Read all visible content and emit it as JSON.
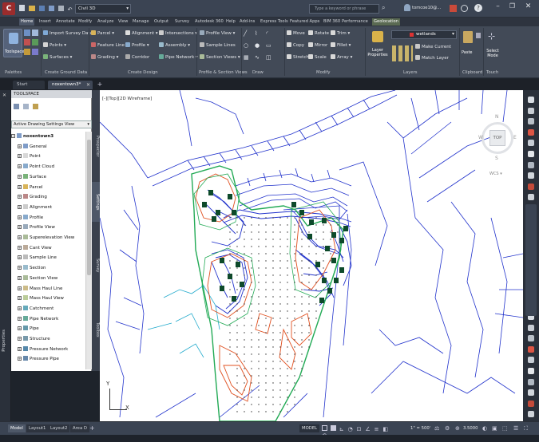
{
  "title_bar": {
    "file_name": "Civil 3D",
    "search_placeholder": "Type a keyword or phrase",
    "user": "tomcoe10@..."
  },
  "ribbon_tabs": [
    "Home",
    "Insert",
    "Annotate",
    "Modify",
    "Analyze",
    "View",
    "Manage",
    "Output",
    "Survey",
    "Autodesk 360",
    "Help",
    "Add-ins",
    "Express Tools",
    "Featured Apps",
    "BIM 360",
    "Performance",
    "Geolocation"
  ],
  "active_ribbon_tab": "Home",
  "ribbon": {
    "toolspace_label": "Toolspace",
    "palettes_label": "Palettes",
    "ground": [
      "Import Survey Data",
      "Points",
      "Surfaces"
    ],
    "ground_panel": "Create Ground Data",
    "design1": [
      "Parcel",
      "Feature Line",
      "Grading"
    ],
    "design2": [
      "Alignment",
      "Profile",
      "Corridor"
    ],
    "design3": [
      "Intersections",
      "Assembly",
      "Pipe Network"
    ],
    "design_panel": "Create Design",
    "profile": [
      "Profile View",
      "Sample Lines",
      "Section Views"
    ],
    "profile_panel": "Profile & Section Views",
    "draw_panel": "Draw",
    "modify": [
      "Move",
      "Rotate",
      "Trim",
      "Copy",
      "Mirror",
      "Fillet",
      "Stretch",
      "Scale",
      "Array"
    ],
    "modify_panel": "Modify",
    "layer_properties": "Layer Properties",
    "layer_name": "wetlands",
    "layer_tools": [
      "Make Current",
      "Match Layer"
    ],
    "layers_panel": "Layers",
    "paste_label": "Paste",
    "clipboard_panel": "Clipboard",
    "select_mode": "Select Mode",
    "touch_panel": "Touch"
  },
  "doc_tabs": [
    "Start",
    "noxentown3*"
  ],
  "active_doc_tab": "noxentown3*",
  "toolspace": {
    "title": "TOOLSPACE",
    "view_select": "Active Drawing Settings View",
    "root": "noxentown3",
    "items": [
      "General",
      "Point",
      "Point Cloud",
      "Surface",
      "Parcel",
      "Grading",
      "Alignment",
      "Profile",
      "Profile View",
      "Superelevation View",
      "Cant View",
      "Sample Line",
      "Section",
      "Section View",
      "Mass Haul Line",
      "Mass Haul View",
      "Catchment",
      "Pipe Network",
      "Pipe",
      "Structure",
      "Pressure Network",
      "Pressure Pipe"
    ]
  },
  "side_tabs": [
    "Prospector",
    "Settings",
    "Survey",
    "Toolbox"
  ],
  "left_strip_label": "Properties",
  "viewport": {
    "label": "[-][Top][2D Wireframe]",
    "viewcube_top": "TOP",
    "compass": [
      "N",
      "S",
      "E",
      "W"
    ],
    "wcs": "WCS",
    "axis_y": "Y",
    "axis_x": "X"
  },
  "layout_tabs": [
    "Model",
    "Layout1",
    "Layout2",
    "Area D"
  ],
  "active_layout_tab": "Model",
  "status": {
    "model": "MODEL",
    "scale": "1\" = 500'",
    "value": "3.5000"
  },
  "colors": {
    "parcel_lines": "#2233cc",
    "contours_red": "#e05020",
    "contours_green": "#22aa55",
    "buildings": "#0d4a2a",
    "stream": "#22aacc"
  }
}
